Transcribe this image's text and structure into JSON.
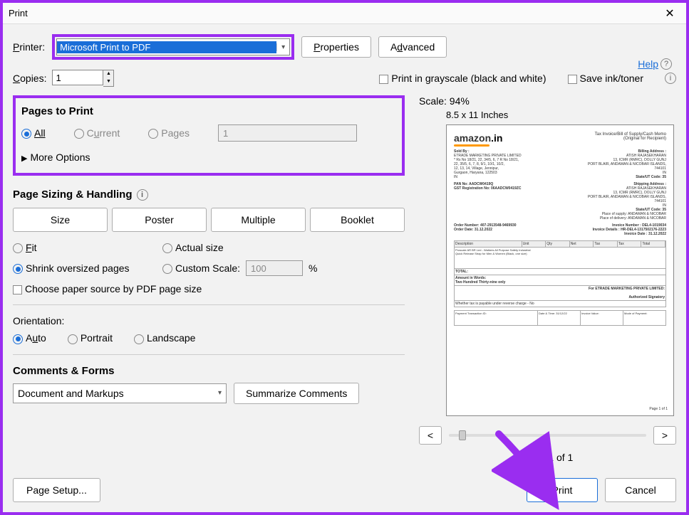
{
  "title": "Print",
  "printer_label": "Printer:",
  "printer_value": "Microsoft Print to PDF",
  "properties_btn": "Properties",
  "advanced_btn": "Advanced",
  "help_text": "Help",
  "copies_label": "Copies:",
  "copies_value": "1",
  "grayscale_label": "Print in grayscale (black and white)",
  "saveink_label": "Save ink/toner",
  "pages_to_print": "Pages to Print",
  "radio_all": "All",
  "radio_current": "Current",
  "radio_pages": "Pages",
  "pages_field": "1",
  "more_options": "More Options",
  "sizing_head": "Page Sizing & Handling",
  "seg": {
    "size": "Size",
    "poster": "Poster",
    "multiple": "Multiple",
    "booklet": "Booklet"
  },
  "fit": "Fit",
  "actual_size": "Actual size",
  "shrink": "Shrink oversized pages",
  "custom_scale": "Custom Scale:",
  "custom_scale_val": "100",
  "pct": "%",
  "choose_paper": "Choose paper source by PDF page size",
  "orientation_label": "Orientation:",
  "orient_auto": "Auto",
  "orient_portrait": "Portrait",
  "orient_landscape": "Landscape",
  "comments_head": "Comments & Forms",
  "comments_value": "Document and Markups",
  "summarize_btn": "Summarize Comments",
  "page_setup_btn": "Page Setup...",
  "print_btn": "Print",
  "cancel_btn": "Cancel",
  "scale_text": "Scale:  94%",
  "paper_dim": "8.5 x 11 Inches",
  "nav_prev": "<",
  "nav_next": ">",
  "page_of": "Page 1 of 1",
  "preview": {
    "brand": "amazon",
    "brand_suffix": ".in",
    "memo": "Tax Invoice/Bill of Supply/Cash Memo",
    "memo2": "(Original for Recipient)",
    "soldby": "Sold By :",
    "seller": "ETRADE MARKETING PRIVATE LIMITED",
    "addr1": "* Rs No 18/21, 22, 34/5, 6, 7 R No 18/21,",
    "addr2": "22, 35/5, 6, 7, 8, 9/1, 10/1, 10/2,",
    "addr3": "12, 13, 14, Village, Jennipur,",
    "addr4": "Gurgaon, Haryana, 122503",
    "in": "IN",
    "bill_lbl": "Billing Address :",
    "bill_name": "ATISH RAJASEKHARAN",
    "bill_l1": "13, ICMR (RMRC), DOLLY GUNJ",
    "bill_l2": "PORT BLAIR, ANDAMAN & NICOBAR ISLANDS,",
    "bill_l3": "744101",
    "bill_state": "State/UT Code: 35",
    "pan": "PAN No: AADCW0419Q",
    "gst": "GST Registration No: 06AADCW0419ZC",
    "ship_lbl": "Shipping Address :",
    "supply": "Place of supply: ANDAMAN & NICOBAR",
    "delivery": "Place of delivery: ANDAMAN & NICOBAR",
    "order_no": "Order Number: 407-2913548-9469930",
    "order_date": "Order Date: 31.12.2022",
    "inv_no": "Invoice Number : DEL4-1019034",
    "inv_det": "Invoice Details : HR-DEL4-1317502176-2223",
    "inv_date": "Invoice Date : 31.12.2022",
    "tbl_h1": "Description",
    "tbl_h2": "Unit",
    "tbl_h3": "Qty",
    "tbl_h4": "Net",
    "tbl_h5": "Tax",
    "tbl_h6": "Tax",
    "tbl_h7": "Total",
    "item1": "Proscale AR BR Led - Walkers All Purpose Safety Industrial",
    "item2": "Quick Release Strap for Men & Women (Black, one size)",
    "total_lbl": "TOTAL:",
    "words_lbl": "Amount in Words:",
    "words": "Two Hundred Thirty-nine only",
    "for_seller": "For ETRADE MARKETING PRIVATE LIMITED:",
    "auth_sig": "Authorized Signatory",
    "reverse": "Whether tax is payable under reverse charge - No",
    "footer_page": "Page 1 of 1"
  }
}
